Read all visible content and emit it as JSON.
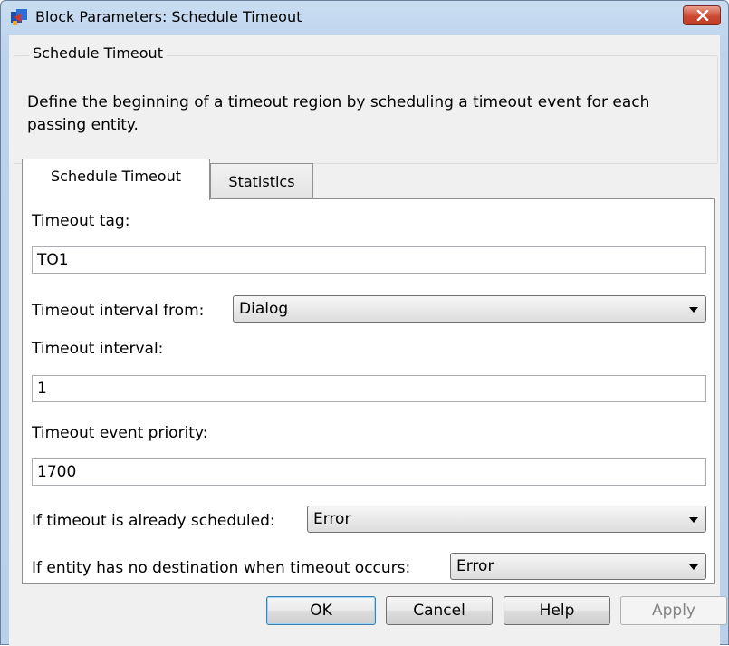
{
  "window": {
    "title": "Block Parameters: Schedule Timeout",
    "close_label": "×"
  },
  "description": {
    "group_title": "Schedule Timeout",
    "text": "Define the beginning of a timeout region by scheduling a timeout event for each passing entity."
  },
  "tabs": [
    {
      "label": "Schedule Timeout",
      "active": true
    },
    {
      "label": "Statistics",
      "active": false
    }
  ],
  "fields": {
    "timeout_tag": {
      "label": "Timeout tag:",
      "value": "TO1"
    },
    "timeout_interval_from": {
      "label": "Timeout interval from:",
      "value": "Dialog"
    },
    "timeout_interval": {
      "label": "Timeout interval:",
      "value": "1"
    },
    "timeout_event_priority": {
      "label": "Timeout event priority:",
      "value": "1700"
    },
    "if_already_scheduled": {
      "label": "If timeout is already scheduled:",
      "value": "Error"
    },
    "no_destination": {
      "label": "If entity has no destination when timeout occurs:",
      "value": "Error"
    }
  },
  "buttons": {
    "ok": "OK",
    "cancel": "Cancel",
    "help": "Help",
    "apply": "Apply"
  },
  "icons": {
    "window_icon": "simulink-block-icon",
    "close": "close-icon",
    "dropdown": "chevron-down-icon"
  },
  "colors": {
    "title_gradient_top": "#c9ddf1",
    "client_bg": "#f0f0f0",
    "close_red": "#cc4a33",
    "default_button_border": "#3c7fb1"
  }
}
